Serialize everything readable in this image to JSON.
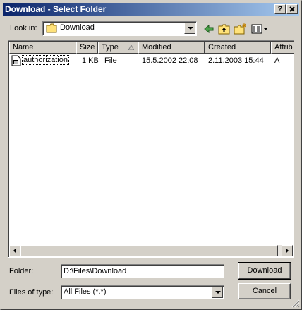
{
  "window": {
    "title": "Download - Select Folder",
    "help_button": "?",
    "close_button": "X"
  },
  "lookin": {
    "label": "Look in:",
    "value": "Download"
  },
  "toolbar": {
    "back_icon": "back-arrow-icon",
    "up_icon": "up-folder-icon",
    "new_folder_icon": "new-folder-icon",
    "view_menu_icon": "view-menu-icon"
  },
  "listview": {
    "columns": [
      {
        "label": "Name"
      },
      {
        "label": "Size"
      },
      {
        "label": "Type"
      },
      {
        "label": "Modified"
      },
      {
        "label": "Created"
      },
      {
        "label": "Attrib"
      }
    ],
    "rows": [
      {
        "name": "authorization",
        "size": "1 KB",
        "type": "File",
        "modified": "15.5.2002 22:08",
        "created": "2.11.2003 15:44",
        "attrib": "A"
      }
    ]
  },
  "folder": {
    "label": "Folder:",
    "value": "D:\\Files\\Download"
  },
  "filetype": {
    "label": "Files of type:",
    "value": "All Files (*.*)"
  },
  "buttons": {
    "download": "Download",
    "cancel": "Cancel"
  },
  "colors": {
    "title_bar_start": "#0a246a",
    "title_bar_end": "#a6caf0",
    "face": "#d4d0c8"
  }
}
